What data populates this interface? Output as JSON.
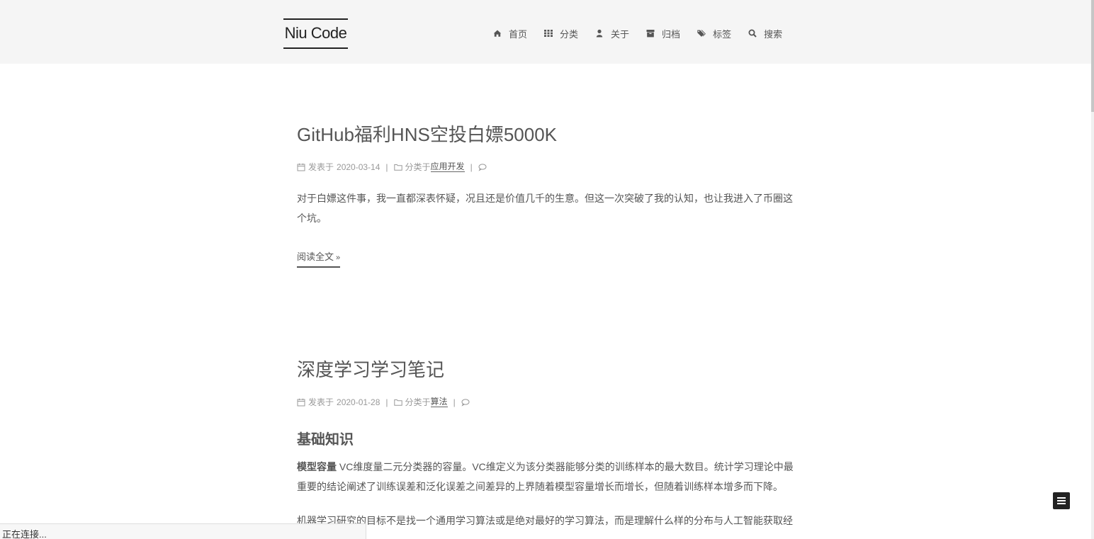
{
  "site": {
    "logo": "Niu Code"
  },
  "nav": {
    "items": [
      {
        "icon": "home-icon",
        "label": "首页"
      },
      {
        "icon": "grid-icon",
        "label": "分类"
      },
      {
        "icon": "user-icon",
        "label": "关于"
      },
      {
        "icon": "archive-icon",
        "label": "归档"
      },
      {
        "icon": "tags-icon",
        "label": "标签"
      },
      {
        "icon": "search-icon",
        "label": "搜索"
      }
    ]
  },
  "posts": [
    {
      "title": "GitHub福利HNS空投白嫖5000K",
      "posted_prefix": "发表于",
      "date": "2020-03-14",
      "category_prefix": "分类于",
      "category": "应用开发",
      "separator": "|",
      "excerpt": "对于白嫖这件事，我一直都深表怀疑，况且还是价值几千的生意。但这一次突破了我的认知，也让我进入了币圈这个坑。",
      "read_more": "阅读全文",
      "read_more_arrow": "»"
    },
    {
      "title": "深度学习学习笔记",
      "posted_prefix": "发表于",
      "date": "2020-01-28",
      "category_prefix": "分类于",
      "category": "算法",
      "separator": "|",
      "section_heading": "基础知识",
      "para1_strong": "模型容量",
      "para1": " VC维度量二元分类器的容量。VC维定义为该分类器能够分类的训练样本的最大数目。统计学习理论中最重要的结论阐述了训练误差和泛化误差之间差异的上界随着模型容量增长而增长，但随着训练样本增多而下降。",
      "para2": "机器学习研究的目标不是找一个通用学习算法或是绝对最好的学习算法，而是理解什么样的分布与人工智能获取经"
    }
  ],
  "status_bar": {
    "text": "正在连接..."
  },
  "colors": {
    "header_bg": "#f5f5f5",
    "text": "#555555",
    "meta": "#999999",
    "logo": "#222222"
  }
}
